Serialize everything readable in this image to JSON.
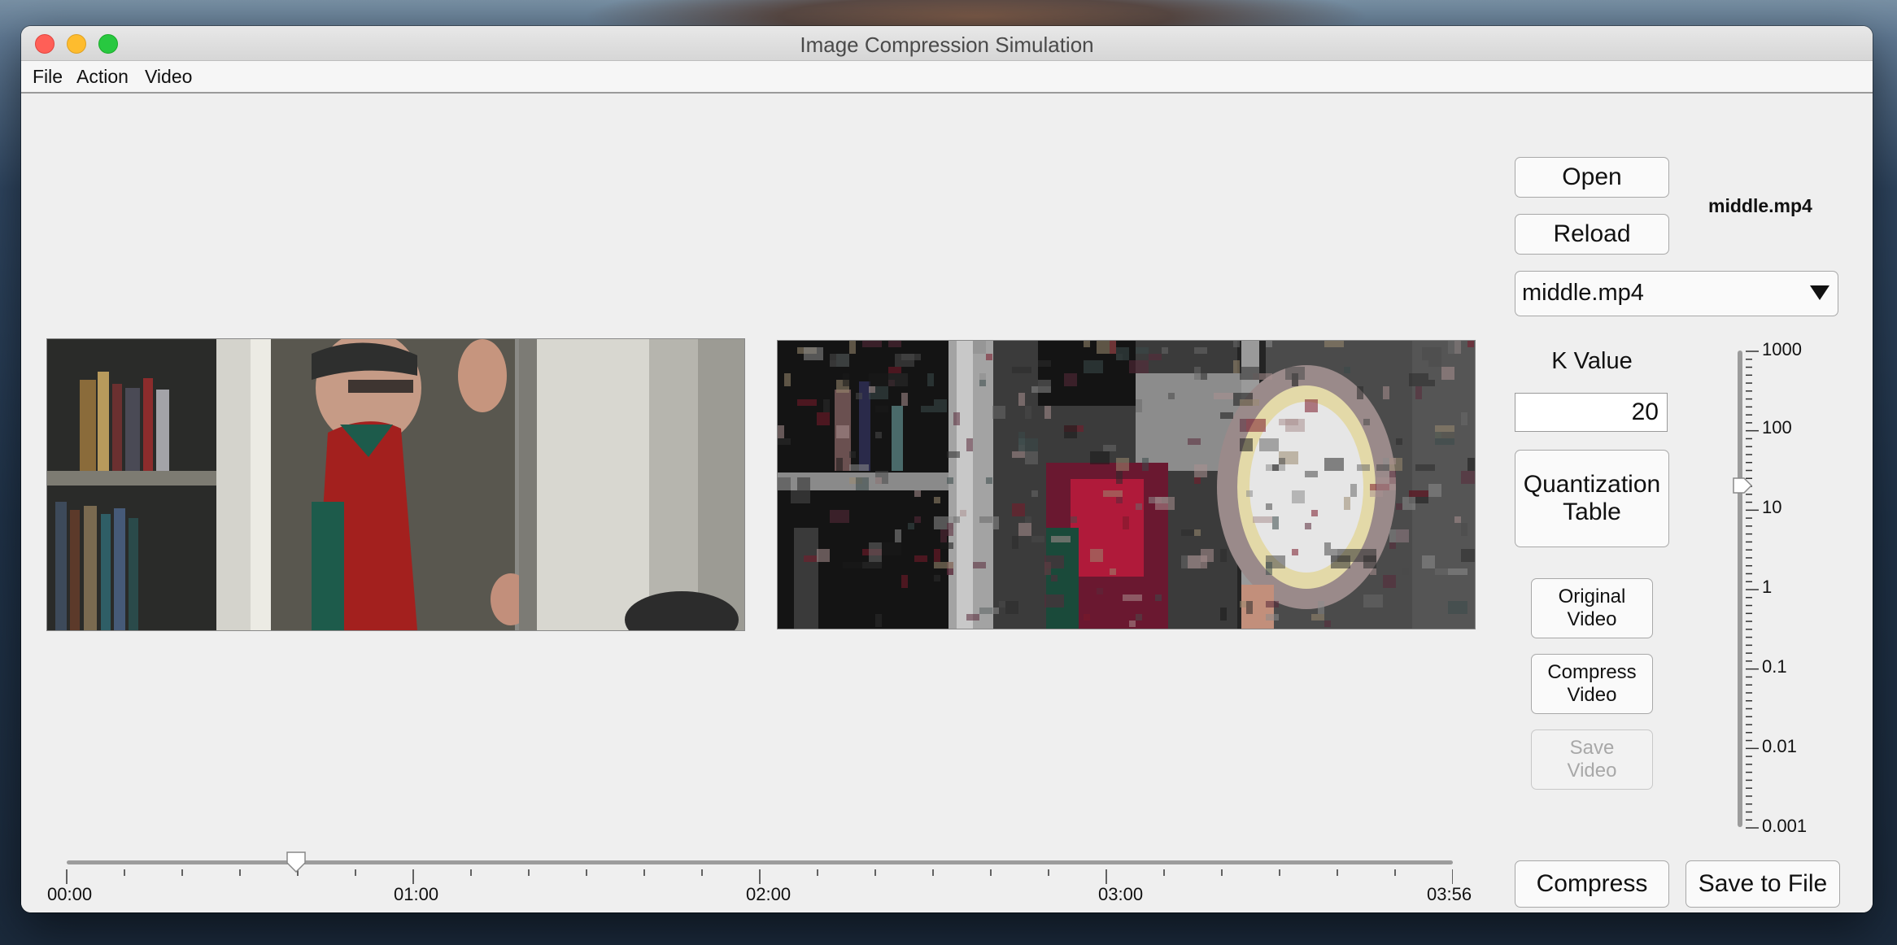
{
  "window": {
    "title": "Image Compression Simulation"
  },
  "menu": [
    "File",
    "Action",
    "Video"
  ],
  "controls": {
    "open_label": "Open",
    "reload_label": "Reload",
    "filename_label": "middle.mp4",
    "dropdown_value": "middle.mp4",
    "k_value_label": "K Value",
    "k_value": "20",
    "quantization_table_line1": "Quantization",
    "quantization_table_line2": "Table",
    "original_video_line1": "Original",
    "original_video_line2": "Video",
    "compress_video_line1": "Compress",
    "compress_video_line2": "Video",
    "save_video_line1": "Save",
    "save_video_line2": "Video",
    "compress_label": "Compress",
    "save_to_file_label": "Save to File"
  },
  "k_slider": {
    "labels": [
      "1000",
      "100",
      "10",
      "1",
      "0.1",
      "0.01",
      "0.001"
    ],
    "value": 20,
    "scale": "log"
  },
  "timeline": {
    "labels": [
      "00:00",
      "01:00",
      "02:00",
      "03:00",
      "03:56"
    ],
    "position": "00:39",
    "duration": "03:56"
  },
  "colors": {
    "window_bg": "#efefef",
    "close": "#ff5f57",
    "minimize": "#febc2e",
    "zoom": "#28c840"
  }
}
